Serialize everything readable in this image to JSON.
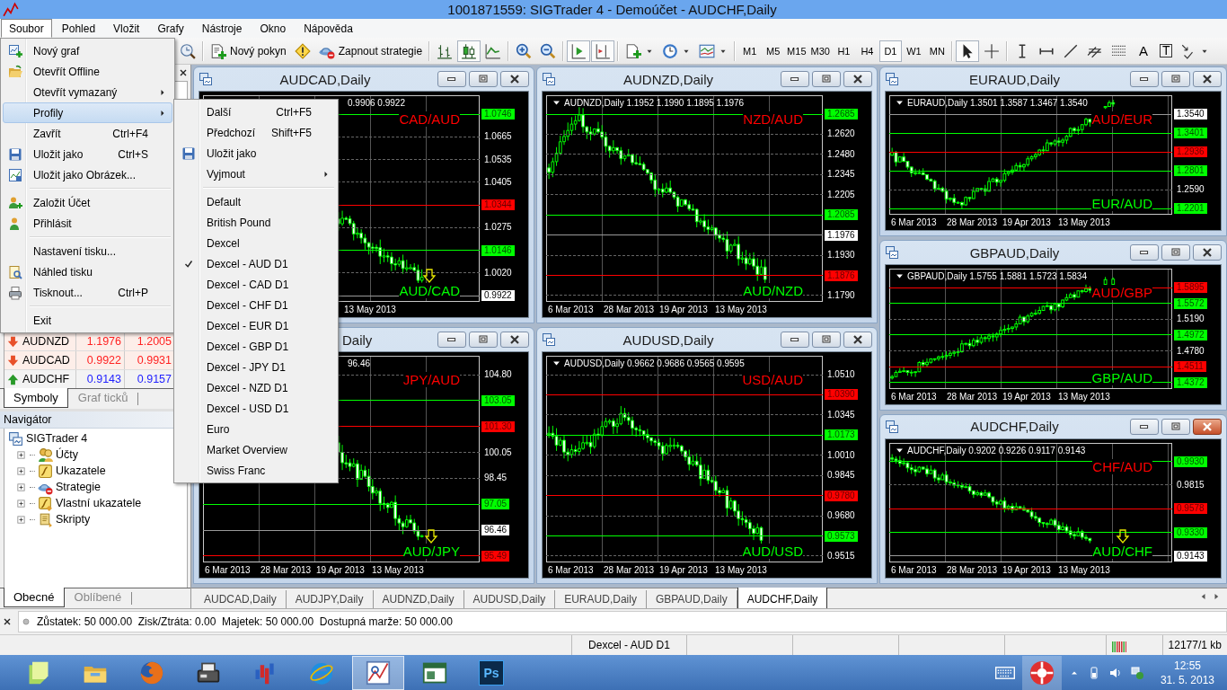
{
  "window": {
    "title": "1001871559: SIGTrader 4 - Demoúčet - AUDCHF,Daily"
  },
  "menu_bar": [
    {
      "label": "Soubor",
      "selected": true
    },
    {
      "label": "Pohled",
      "selected": false
    },
    {
      "label": "Vložit",
      "selected": false
    },
    {
      "label": "Grafy",
      "selected": false
    },
    {
      "label": "Nástroje",
      "selected": false
    },
    {
      "label": "Okno",
      "selected": false
    },
    {
      "label": "Nápověda",
      "selected": false
    }
  ],
  "toolbar": {
    "groups": [
      [
        {
          "kind": "history",
          "pressed": false
        }
      ],
      [
        {
          "kind": "new-order",
          "label": "Nový pokyn",
          "pressed": false
        },
        {
          "kind": "alert",
          "pressed": false
        },
        {
          "kind": "strategy",
          "label": "Zapnout strategie",
          "pressed": false
        }
      ],
      [
        {
          "kind": "bars",
          "pressed": false
        },
        {
          "kind": "candles",
          "pressed": true
        },
        {
          "kind": "line",
          "pressed": false
        }
      ],
      [
        {
          "kind": "zoom-in",
          "pressed": false
        },
        {
          "kind": "zoom-out",
          "pressed": false
        }
      ],
      [
        {
          "kind": "autoscroll",
          "pressed": true
        },
        {
          "kind": "shift",
          "pressed": true
        }
      ],
      [
        {
          "kind": "indicators",
          "pressed": false,
          "dropdown": true
        },
        {
          "kind": "periods",
          "pressed": false,
          "dropdown": true
        },
        {
          "kind": "templates",
          "pressed": false,
          "dropdown": true
        }
      ],
      [
        {
          "kind": "timeframe",
          "label": "M1",
          "selected": false
        },
        {
          "kind": "timeframe",
          "label": "M5",
          "selected": false
        },
        {
          "kind": "timeframe",
          "label": "M15",
          "selected": false
        },
        {
          "kind": "timeframe",
          "label": "M30",
          "selected": false
        },
        {
          "kind": "timeframe",
          "label": "H1",
          "selected": false
        },
        {
          "kind": "timeframe",
          "label": "H4",
          "selected": false
        },
        {
          "kind": "timeframe",
          "label": "D1",
          "selected": true
        },
        {
          "kind": "timeframe",
          "label": "W1",
          "selected": false
        },
        {
          "kind": "timeframe",
          "label": "MN",
          "selected": false
        }
      ],
      [
        {
          "kind": "cursor",
          "pressed": true
        },
        {
          "kind": "crosshair",
          "pressed": false
        }
      ],
      [
        {
          "kind": "vline",
          "pressed": false
        },
        {
          "kind": "hline",
          "pressed": false
        },
        {
          "kind": "trendline",
          "pressed": false
        },
        {
          "kind": "channel",
          "pressed": false
        },
        {
          "kind": "fibo",
          "pressed": false
        },
        {
          "kind": "text",
          "label": "A",
          "pressed": false
        },
        {
          "kind": "text-label",
          "label": "T",
          "pressed": false
        },
        {
          "kind": "arrows",
          "pressed": false,
          "dropdown": true
        }
      ]
    ]
  },
  "market_watch": {
    "rows": [
      {
        "symbol": "AUDNZD",
        "bid": "1.1976",
        "ask": "1.2005",
        "kind": "down"
      },
      {
        "symbol": "AUDCAD",
        "bid": "0.9922",
        "ask": "0.9931",
        "kind": "down"
      },
      {
        "symbol": "AUDCHF",
        "bid": "0.9143",
        "ask": "0.9157",
        "kind": "up"
      }
    ],
    "tabs": [
      {
        "label": "Symboly",
        "selected": true
      },
      {
        "label": "Graf ticků",
        "selected": false
      }
    ]
  },
  "navigator": {
    "title": "Navigátor",
    "tree": [
      {
        "label": "SIGTrader 4",
        "kind": "terminal",
        "children": [
          {
            "label": "Účty",
            "kind": "accounts",
            "expanded": false
          },
          {
            "label": "Ukazatele",
            "kind": "indicator",
            "expanded": false
          },
          {
            "label": "Strategie",
            "kind": "strategy",
            "expanded": false
          },
          {
            "label": "Vlastní ukazatele",
            "kind": "custom",
            "expanded": false
          },
          {
            "label": "Skripty",
            "kind": "scripts",
            "expanded": false
          }
        ]
      }
    ],
    "tabs": [
      {
        "label": "Obecné",
        "selected": true
      },
      {
        "label": "Oblíbené",
        "selected": false
      }
    ]
  },
  "mdi": {
    "columns": [
      [
        {
          "title": "AUDCAD,Daily",
          "active": false,
          "kind": "falling",
          "info": {
            "values": "0.9906 0.9922"
          },
          "levels": [
            {
              "price": "1.0746",
              "kind": "green"
            },
            {
              "price": "1.0665",
              "kind": "plain"
            },
            {
              "price": "1.0535",
              "kind": "plain"
            },
            {
              "price": "1.0405",
              "kind": "plain"
            },
            {
              "price": "1.0344",
              "kind": "red"
            },
            {
              "price": "1.0275",
              "kind": "plain"
            },
            {
              "price": "1.0146",
              "kind": "green"
            },
            {
              "price": "1.0020",
              "kind": "plain"
            },
            {
              "price": "0.9922",
              "kind": "white"
            }
          ],
          "pair_top": "CAD/AUD",
          "pair_bottom": "AUD/CAD",
          "signal_arrow": true,
          "dates": [
            "13 May 2013"
          ]
        },
        {
          "title": "Daily",
          "active": false,
          "kind": "flat-fall",
          "info": {
            "values": "96.46"
          },
          "levels": [
            {
              "price": "104.80",
              "kind": "plain"
            },
            {
              "price": "103.05",
              "kind": "green"
            },
            {
              "price": "101.30",
              "kind": "red"
            },
            {
              "price": "100.05",
              "kind": "plain"
            },
            {
              "price": "98.45",
              "kind": "plain"
            },
            {
              "price": "97.05",
              "kind": "green"
            },
            {
              "price": "96.46",
              "kind": "white"
            },
            {
              "price": "95.49",
              "kind": "red"
            }
          ],
          "pair_top": "JPY/AUD",
          "pair_bottom": "AUD/JPY",
          "signal_arrow": true,
          "dates": [
            "6 Mar 2013",
            "28 Mar 2013",
            "19 Apr 2013",
            "13 May 2013"
          ]
        }
      ],
      [
        {
          "title": "AUDNZD,Daily",
          "active": false,
          "kind": "peak-fall",
          "info": {
            "symbol": "AUDNZD,Daily",
            "values": "1.1952 1.1990 1.1895 1.1976"
          },
          "levels": [
            {
              "price": "1.2685",
              "kind": "green"
            },
            {
              "price": "1.2620",
              "kind": "plain"
            },
            {
              "price": "1.2480",
              "kind": "plain"
            },
            {
              "price": "1.2345",
              "kind": "plain"
            },
            {
              "price": "1.2205",
              "kind": "plain"
            },
            {
              "price": "1.2085",
              "kind": "green"
            },
            {
              "price": "1.1976",
              "kind": "white"
            },
            {
              "price": "1.1930",
              "kind": "plain"
            },
            {
              "price": "1.1876",
              "kind": "red"
            },
            {
              "price": "1.1790",
              "kind": "plain"
            }
          ],
          "pair_top": "NZD/AUD",
          "pair_bottom": "AUD/NZD",
          "dates": [
            "6 Mar 2013",
            "28 Mar 2013",
            "19 Apr 2013",
            "13 May 2013"
          ]
        },
        {
          "title": "AUDUSD,Daily",
          "active": false,
          "kind": "flat-fall",
          "info": {
            "symbol": "AUDUSD,Daily",
            "values": "0.9662 0.9686 0.9565 0.9595"
          },
          "levels": [
            {
              "price": "1.0510",
              "kind": "plain"
            },
            {
              "price": "1.0390",
              "kind": "red"
            },
            {
              "price": "1.0345",
              "kind": "plain"
            },
            {
              "price": "1.0173",
              "kind": "green"
            },
            {
              "price": "1.0010",
              "kind": "plain"
            },
            {
              "price": "0.9845",
              "kind": "plain"
            },
            {
              "price": "0.9780",
              "kind": "red"
            },
            {
              "price": "0.9680",
              "kind": "plain"
            },
            {
              "price": "0.9573",
              "kind": "green"
            },
            {
              "price": "0.9515",
              "kind": "plain"
            }
          ],
          "pair_top": "USD/AUD",
          "pair_bottom": "AUD/USD",
          "dates": [
            "6 Mar 2013",
            "28 Mar 2013",
            "19 Apr 2013",
            "13 May 2013"
          ]
        }
      ],
      [
        {
          "title": "EURAUD,Daily",
          "active": false,
          "kind": "dip-rise",
          "info": {
            "symbol": "EURAUD,Daily",
            "values": "1.3501 1.3587 1.3467 1.3540"
          },
          "levels": [
            {
              "price": "1.3540",
              "kind": "white"
            },
            {
              "price": "1.3401",
              "kind": "green"
            },
            {
              "price": "1.2936",
              "kind": "red"
            },
            {
              "price": "1.2801",
              "kind": "green"
            },
            {
              "price": "1.2590",
              "kind": "plain"
            },
            {
              "price": "1.2201",
              "kind": "green"
            }
          ],
          "pair_top": "AUD/EUR",
          "pair_bottom": "EUR/AUD",
          "dates": [
            "6 Mar 2013",
            "28 Mar 2013",
            "19 Apr 2013",
            "13 May 2013"
          ]
        },
        {
          "title": "GBPAUD,Daily",
          "active": false,
          "kind": "rising",
          "info": {
            "symbol": "GBPAUD,Daily",
            "values": "1.5755 1.5881 1.5723 1.5834"
          },
          "levels": [
            {
              "price": "1.5895",
              "kind": "red"
            },
            {
              "price": "1.5572",
              "kind": "green"
            },
            {
              "price": "1.5190",
              "kind": "plain"
            },
            {
              "price": "1.4972",
              "kind": "green"
            },
            {
              "price": "1.4780",
              "kind": "plain"
            },
            {
              "price": "1.4511",
              "kind": "red"
            },
            {
              "price": "1.4372",
              "kind": "green"
            }
          ],
          "pair_top": "AUD/GBP",
          "pair_bottom": "GBP/AUD",
          "dates": [
            "6 Mar 2013",
            "28 Mar 2013",
            "19 Apr 2013",
            "13 May 2013"
          ]
        },
        {
          "title": "AUDCHF,Daily",
          "active": true,
          "kind": "falling",
          "info": {
            "symbol": "AUDCHF,Daily",
            "values": "0.9202 0.9226 0.9117 0.9143"
          },
          "levels": [
            {
              "price": "0.9930",
              "kind": "green"
            },
            {
              "price": "0.9815",
              "kind": "plain"
            },
            {
              "price": "0.9578",
              "kind": "red"
            },
            {
              "price": "0.9330",
              "kind": "green"
            },
            {
              "price": "0.9143",
              "kind": "white"
            }
          ],
          "pair_top": "CHF/AUD",
          "pair_bottom": "AUD/CHF",
          "signal_arrow": true,
          "dates": [
            "6 Mar 2013",
            "28 Mar 2013",
            "19 Apr 2013",
            "13 May 2013"
          ]
        }
      ]
    ]
  },
  "chart_tabs": [
    {
      "label": "AUDCAD,Daily",
      "selected": false
    },
    {
      "label": "AUDJPY,Daily",
      "selected": false
    },
    {
      "label": "AUDNZD,Daily",
      "selected": false
    },
    {
      "label": "AUDUSD,Daily",
      "selected": false
    },
    {
      "label": "EURAUD,Daily",
      "selected": false
    },
    {
      "label": "GBPAUD,Daily",
      "selected": false
    },
    {
      "label": "AUDCHF,Daily",
      "selected": true
    }
  ],
  "terminal": {
    "summary": "Zůstatek: 50 000.00  Zisk/Ztráta: 0.00  Majetek: 50 000.00  Dostupná marže: 50 000.00"
  },
  "status_bar": {
    "profile": "Dexcel - AUD D1",
    "traffic": "12177/1 kb"
  },
  "taskbar": {
    "apps": [
      {
        "kind": "notes",
        "active": false
      },
      {
        "kind": "explorer",
        "active": false
      },
      {
        "kind": "firefox",
        "active": false
      },
      {
        "kind": "device",
        "active": false
      },
      {
        "kind": "bars-app",
        "active": false
      },
      {
        "kind": "ie",
        "active": false
      },
      {
        "kind": "sig",
        "active": true
      },
      {
        "kind": "window-app",
        "active": false
      },
      {
        "kind": "photoshop",
        "label": "Ps",
        "active": false
      }
    ],
    "clock": {
      "time": "12:55",
      "date": "31. 5. 2013"
    }
  },
  "file_menu": {
    "items": [
      {
        "kind": "new-chart",
        "label": "Nový graf",
        "selected": false
      },
      {
        "kind": "open-offline",
        "label": "Otevřít Offline",
        "selected": false
      },
      {
        "kind": "plain",
        "label": "Otevřít vymazaný",
        "submenu": true,
        "selected": false
      },
      {
        "kind": "plain",
        "label": "Profily",
        "submenu": true,
        "selected": true
      },
      {
        "kind": "plain",
        "label": "Zavřít",
        "shortcut": "Ctrl+F4",
        "selected": false
      },
      {
        "kind": "save",
        "label": "Uložit jako",
        "shortcut": "Ctrl+S",
        "selected": false
      },
      {
        "kind": "save-image",
        "label": "Uložit jako Obrázek...",
        "selected": false
      },
      {
        "kind": "separator"
      },
      {
        "kind": "account",
        "label": "Založit Účet",
        "selected": false
      },
      {
        "kind": "login",
        "label": "Přihlásit",
        "selected": false
      },
      {
        "kind": "separator"
      },
      {
        "kind": "plain",
        "label": "Nastavení tisku...",
        "selected": false
      },
      {
        "kind": "preview",
        "label": "Náhled tisku",
        "selected": false
      },
      {
        "kind": "print",
        "label": "Tisknout...",
        "shortcut": "Ctrl+P",
        "selected": false
      },
      {
        "kind": "separator"
      },
      {
        "kind": "plain",
        "label": "Exit",
        "selected": false
      }
    ]
  },
  "profiles_menu": {
    "items": [
      {
        "kind": "plain",
        "label": "Další",
        "shortcut": "Ctrl+F5",
        "selected": false,
        "checked": false
      },
      {
        "kind": "plain",
        "label": "Předchozí",
        "shortcut": "Shift+F5",
        "selected": false,
        "checked": false
      },
      {
        "kind": "save",
        "label": "Uložit jako",
        "selected": false,
        "checked": false
      },
      {
        "kind": "plain",
        "label": "Vyjmout",
        "submenu": true,
        "selected": false,
        "checked": false
      },
      {
        "kind": "separator"
      },
      {
        "kind": "plain",
        "label": "Default",
        "selected": false,
        "checked": false
      },
      {
        "kind": "plain",
        "label": "British Pound",
        "selected": false,
        "checked": false
      },
      {
        "kind": "plain",
        "label": "Dexcel",
        "selected": false,
        "checked": false
      },
      {
        "kind": "plain",
        "label": "Dexcel - AUD D1",
        "selected": false,
        "checked": true
      },
      {
        "kind": "plain",
        "label": "Dexcel - CAD D1",
        "selected": false,
        "checked": false
      },
      {
        "kind": "plain",
        "label": "Dexcel - CHF D1",
        "selected": false,
        "checked": false
      },
      {
        "kind": "plain",
        "label": "Dexcel - EUR D1",
        "selected": false,
        "checked": false
      },
      {
        "kind": "plain",
        "label": "Dexcel - GBP D1",
        "selected": false,
        "checked": false
      },
      {
        "kind": "plain",
        "label": "Dexcel - JPY D1",
        "selected": false,
        "checked": false
      },
      {
        "kind": "plain",
        "label": "Dexcel - NZD D1",
        "selected": false,
        "checked": false
      },
      {
        "kind": "plain",
        "label": "Dexcel - USD D1",
        "selected": false,
        "checked": false
      },
      {
        "kind": "plain",
        "label": "Euro",
        "selected": false,
        "checked": false
      },
      {
        "kind": "plain",
        "label": "Market Overview",
        "selected": false,
        "checked": false
      },
      {
        "kind": "plain",
        "label": "Swiss Franc",
        "selected": false,
        "checked": false
      }
    ]
  }
}
